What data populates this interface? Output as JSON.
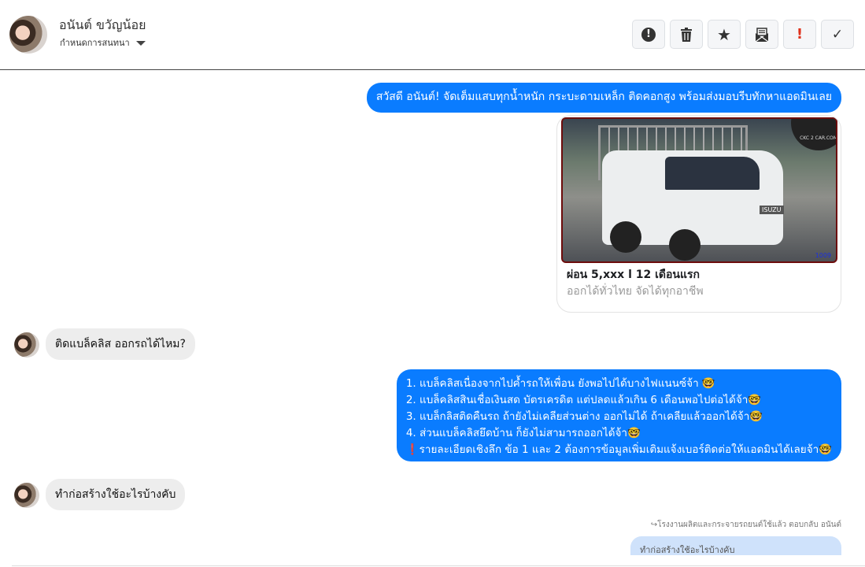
{
  "header": {
    "name": "อนันต์ ขวัญน้อย",
    "subtitle": "กำหนดการสนทนา",
    "tools": [
      {
        "icon": "alert-circle-icon",
        "glyph": "⬤"
      },
      {
        "icon": "trash-icon",
        "glyph": "🗑"
      },
      {
        "icon": "star-icon",
        "glyph": "★"
      },
      {
        "icon": "mail-open-icon",
        "glyph": "✉"
      },
      {
        "icon": "exclamation-icon",
        "glyph": "!"
      },
      {
        "icon": "check-icon",
        "glyph": "✓"
      }
    ]
  },
  "messages": {
    "m1": "สวัสดี อนันต์! จัดเต็มแสบทุกน้ำหนัก กระบะดามเหล็ก ติดคอกสูง พร้อมส่งมอบรีบทักหาแอดมินเลย",
    "card": {
      "image_text": "CKC 2 CAR.COM",
      "badge": "ISUZU",
      "image_number": "1009",
      "title": "ผ่อน 5,xxx l 12 เดือนแรก",
      "subtitle": "ออกได้ทั่วไทย จัดได้ทุกอาชีพ"
    },
    "m2": "ติดแบล็คลิส ออกรถได้ไหม?",
    "m3_lines": [
      "1. แบล็คลิสเนื่องจากไปค้ำรถให้เพื่อน ยังพอไปได้บางไฟแนนซ์จ้า 🤓",
      "2. แบล็คลิสสินเชื่อเงินสด บัตรเครดิต แต่ปลดแล้วเกิน 6 เดือนพอไปต่อได้จ้า🤓",
      "3. แบล็กลิสติดคืนรถ ถ้ายังไม่เคลียส่วนต่าง ออกไม่ได้ ถ้าเคลียแล้วออกได้จ้า🤓",
      "4. ส่วนแบล็คลิสยึดบ้าน ก็ยังไม่สามารถออกได้จ้า🤓",
      "❗รายละเอียดเชิงลึก ข้อ 1 และ 2 ต้องการข้อมูลเพิ่มเติมแจ้งเบอร์ติดต่อให้แอดมินได้เลยจ้า🤓"
    ],
    "m4": "ทำก่อสร้างใช้อะไรบ้างคับ",
    "reply_note": "↪โรงงานผลิตและกระจายรถยนต์ใช้แล้ว ตอบกลับ อนันต์",
    "reply_quote": "ทำก่อสร้างใช้อะไรบ้างคับ"
  },
  "colors": {
    "outgoing": "#0a7cff",
    "incoming": "#ededed",
    "reply": "#cfe2fb"
  }
}
